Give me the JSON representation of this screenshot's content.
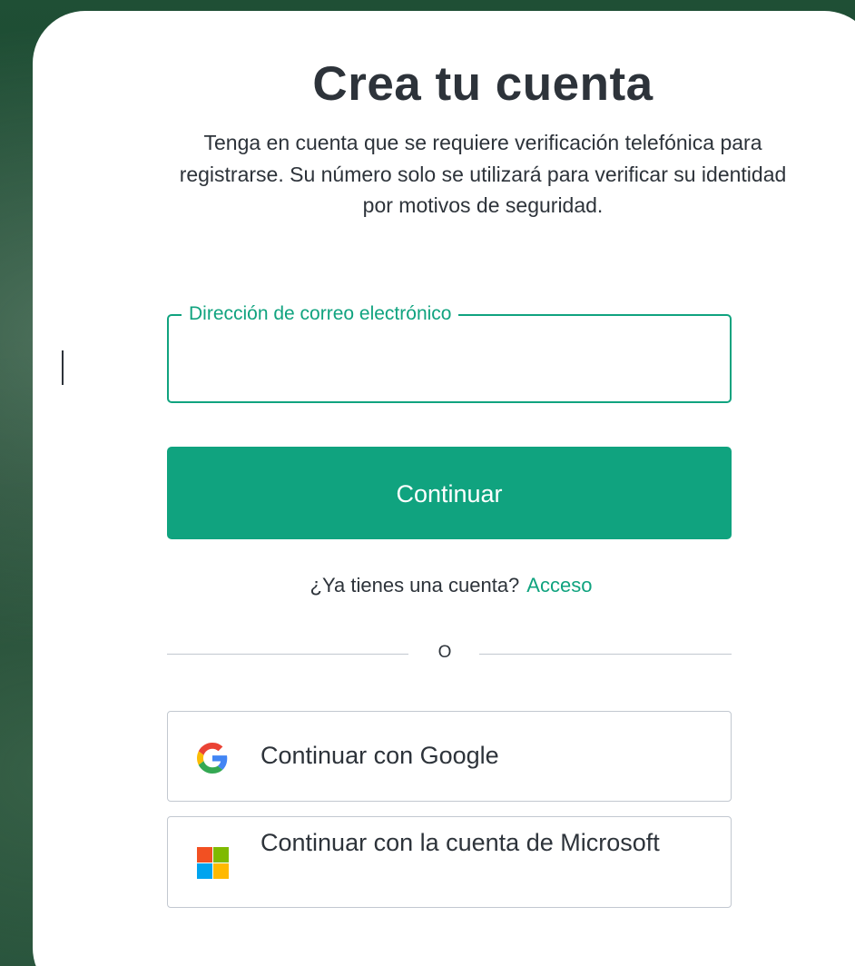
{
  "signup": {
    "title": "Crea tu cuenta",
    "notice": "Tenga en cuenta que se requiere verificación telefónica para registrarse. Su número solo se utilizará para verificar su identidad por motivos de seguridad.",
    "email_field": {
      "label": "Dirección de correo electrónico",
      "value": "",
      "placeholder": ""
    },
    "continue_label": "Continuar",
    "login_prompt": "¿Ya tienes una cuenta?",
    "login_link": "Acceso",
    "divider_text": "O",
    "google": {
      "label": "Continuar con Google",
      "icon": "google-logo-icon"
    },
    "microsoft": {
      "label": "Continuar con la cuenta de Microsoft",
      "icon": "microsoft-logo-icon"
    }
  },
  "colors": {
    "accent": "#10a37f",
    "text": "#2d333a",
    "border": "#c2c8d0",
    "background": "#1f4f35",
    "card": "#ffffff"
  }
}
